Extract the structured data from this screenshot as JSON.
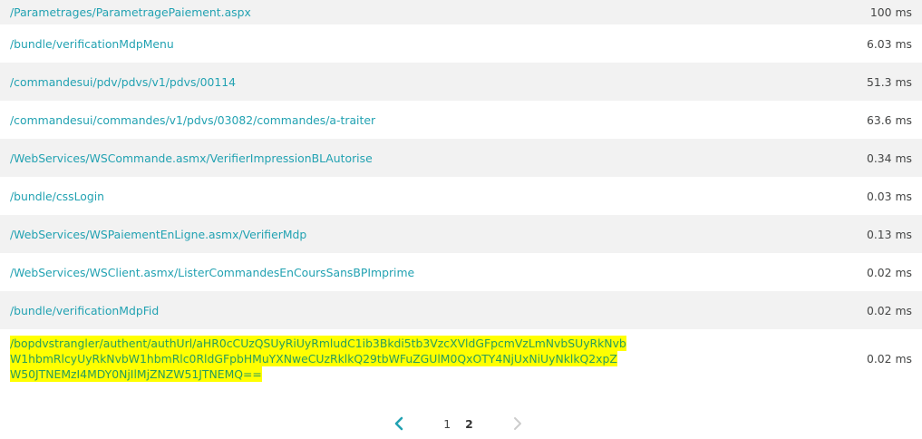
{
  "rows": [
    {
      "path": "/Parametrages/ParametragePaiement.aspx",
      "time": "100 ms"
    },
    {
      "path": "/bundle/verificationMdpMenu",
      "time": "6.03 ms"
    },
    {
      "path": "/commandesui/pdv/pdvs/v1/pdvs/00114",
      "time": "51.3 ms"
    },
    {
      "path": "/commandesui/commandes/v1/pdvs/03082/commandes/a-traiter",
      "time": "63.6 ms"
    },
    {
      "path": "/WebServices/WSCommande.asmx/VerifierImpressionBLAutorise",
      "time": "0.34 ms"
    },
    {
      "path": "/bundle/cssLogin",
      "time": "0.03 ms"
    },
    {
      "path": "/WebServices/WSPaiementEnLigne.asmx/VerifierMdp",
      "time": "0.13 ms"
    },
    {
      "path": "/WebServices/WSClient.asmx/ListerCommandesEnCoursSansBPImprime",
      "time": "0.02 ms"
    },
    {
      "path": "/bundle/verificationMdpFid",
      "time": "0.02 ms"
    },
    {
      "path_lines": [
        "/bopdvstrangler/authent/authUrl/aHR0cCUzQSUyRiUyRmludC1ib3Bkdi5tb3VzcXVldGFpcmVzLmNvbSUyRkNvb",
        "W1hbmRlcyUyRkNvbW1hbmRlc0RldGFpbHMuYXNweCUzRklkQ29tbWFuZGUlM0QxOTY4NjUxNiUyNklkQ2xpZ",
        "W50JTNEMzI4MDY0NjIlMjZNZW51JTNEMQ=="
      ],
      "time": "0.02 ms"
    }
  ],
  "pagination": {
    "pages": [
      "1",
      "2"
    ],
    "active_page": "2"
  },
  "colors": {
    "link": "#22a2b2",
    "highlight": "#ffff00",
    "stripe": "#f2f2f2",
    "prev_arrow": "#22a2b2",
    "next_arrow": "#cccccc"
  }
}
